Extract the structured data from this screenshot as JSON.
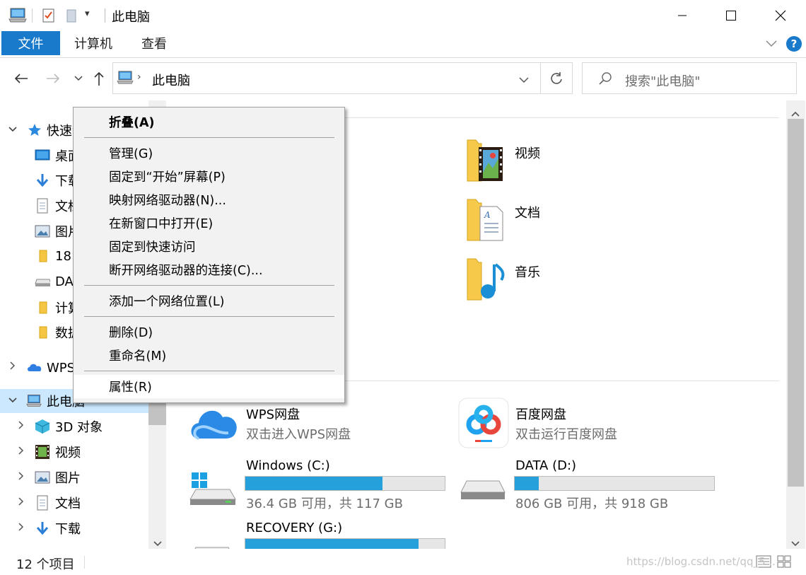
{
  "window": {
    "title": "此电脑",
    "controls": [
      "minimize",
      "maximize",
      "close"
    ]
  },
  "ribbon": {
    "tabs": [
      {
        "label": "文件",
        "active": true
      },
      {
        "label": "计算机",
        "active": false
      },
      {
        "label": "查看",
        "active": false
      }
    ],
    "help": "?"
  },
  "nav": {
    "breadcrumb": [
      "此电脑"
    ],
    "search_placeholder": "搜索\"此电脑\""
  },
  "sidebar": {
    "items": [
      {
        "label": "快速访问",
        "icon": "star-icon",
        "level": 0,
        "expanded": true
      },
      {
        "label": "桌面",
        "icon": "desktop-icon",
        "level": 1
      },
      {
        "label": "下载",
        "icon": "download-icon",
        "level": 1
      },
      {
        "label": "文档",
        "icon": "document-icon",
        "level": 1
      },
      {
        "label": "图片",
        "icon": "picture-icon",
        "level": 1
      },
      {
        "label": "18",
        "icon": "folder-icon",
        "level": 1
      },
      {
        "label": "DA",
        "icon": "drive-icon",
        "level": 1
      },
      {
        "label": "计算",
        "icon": "folder-icon",
        "level": 1
      },
      {
        "label": "数据",
        "icon": "folder-icon",
        "level": 1
      },
      {
        "label": "WPS网盘",
        "icon": "cloud-icon",
        "level": 0,
        "expanded": false
      },
      {
        "label": "此电脑",
        "icon": "computer-icon",
        "level": 0,
        "expanded": true,
        "selected": true
      },
      {
        "label": "3D 对象",
        "icon": "cube-icon",
        "level": 1
      },
      {
        "label": "视频",
        "icon": "video-icon",
        "level": 1
      },
      {
        "label": "图片",
        "icon": "picture-icon",
        "level": 1
      },
      {
        "label": "文档",
        "icon": "document-icon",
        "level": 1
      },
      {
        "label": "下载",
        "icon": "download-icon",
        "level": 1
      }
    ]
  },
  "content": {
    "folders": [
      {
        "label": "视频",
        "icon": "video-folder-icon"
      },
      {
        "label": "文档",
        "icon": "document-folder-icon"
      },
      {
        "label": "音乐",
        "icon": "music-folder-icon"
      }
    ],
    "cloud": [
      {
        "label": "WPS网盘",
        "sub": "双击进入WPS网盘",
        "icon": "wps-cloud-icon"
      },
      {
        "label": "百度网盘",
        "sub": "双击运行百度网盘",
        "icon": "baidu-netdisk-icon"
      }
    ],
    "drives": [
      {
        "label": "Windows (C:)",
        "sub": "36.4 GB 可用，共 117 GB",
        "used_fraction": 0.689,
        "icon": "windows-drive-icon"
      },
      {
        "label": "DATA (D:)",
        "sub": "806 GB 可用，共 918 GB",
        "used_fraction": 0.122,
        "icon": "drive-icon"
      },
      {
        "label": "RECOVERY (G:)",
        "sub": "",
        "used_fraction": 0.87,
        "icon": "drive-icon"
      }
    ]
  },
  "context_menu": {
    "items": [
      {
        "label": "折叠(A)",
        "bold": true
      },
      {
        "sep": true
      },
      {
        "label": "管理(G)"
      },
      {
        "label": "固定到“开始”屏幕(P)"
      },
      {
        "label": "映射网络驱动器(N)..."
      },
      {
        "label": "在新窗口中打开(E)"
      },
      {
        "label": "固定到快速访问"
      },
      {
        "label": "断开网络驱动器的连接(C)..."
      },
      {
        "sep": true
      },
      {
        "label": "添加一个网络位置(L)"
      },
      {
        "sep": true
      },
      {
        "label": "删除(D)"
      },
      {
        "label": "重命名(M)"
      },
      {
        "sep": true
      },
      {
        "label": "属性(R)",
        "hover": true
      }
    ]
  },
  "status": {
    "count": "12 个项目",
    "watermark": "https://blog.csdn.net/qq_5..."
  },
  "colors": {
    "accent": "#1979ca",
    "selection": "#cce8ff",
    "drive_fill": "#26a0da"
  }
}
